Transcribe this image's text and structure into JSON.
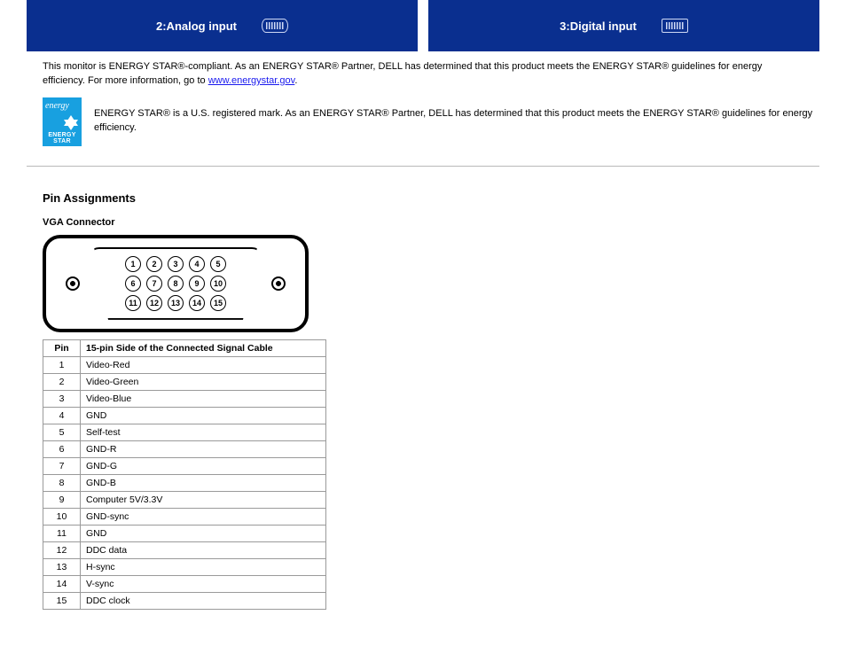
{
  "banners": {
    "analog": {
      "label": "2:Analog input",
      "icon": "vga-port-icon"
    },
    "digital": {
      "label": "3:Digital input",
      "icon": "dvi-port-icon"
    }
  },
  "intro_paragraph": "This monitor is ENERGY STAR®-compliant. As an ENERGY STAR® Partner, DELL has determined that this product meets the ENERGY STAR® guidelines for energy efficiency.",
  "link_text": "www.energystar.gov",
  "link_prefix": "For more information, go to ",
  "link_suffix": ".",
  "energy_star": {
    "line1": "energy",
    "line2": "ENERGY STAR"
  },
  "estar_note": "ENERGY STAR® is a U.S. registered mark. As an ENERGY STAR® Partner, DELL has determined that this product meets the ENERGY STAR® guidelines for energy efficiency.",
  "pin_heading": "Pin Assignments",
  "vga_heading": "VGA Connector",
  "pin_table": {
    "headers": [
      "Pin",
      "15-pin Side of the Connected Signal Cable"
    ],
    "rows": [
      [
        "1",
        "Video-Red"
      ],
      [
        "2",
        "Video-Green"
      ],
      [
        "3",
        "Video-Blue"
      ],
      [
        "4",
        "GND"
      ],
      [
        "5",
        "Self-test"
      ],
      [
        "6",
        "GND-R"
      ],
      [
        "7",
        "GND-G"
      ],
      [
        "8",
        "GND-B"
      ],
      [
        "9",
        "Computer 5V/3.3V"
      ],
      [
        "10",
        "GND-sync"
      ],
      [
        "11",
        "GND"
      ],
      [
        "12",
        "DDC data"
      ],
      [
        "13",
        "H-sync"
      ],
      [
        "14",
        "V-sync"
      ],
      [
        "15",
        "DDC clock"
      ]
    ]
  },
  "pins": {
    "row1": [
      "1",
      "2",
      "3",
      "4",
      "5"
    ],
    "row2": [
      "6",
      "7",
      "8",
      "9",
      "10"
    ],
    "row3": [
      "11",
      "12",
      "13",
      "14",
      "15"
    ]
  }
}
